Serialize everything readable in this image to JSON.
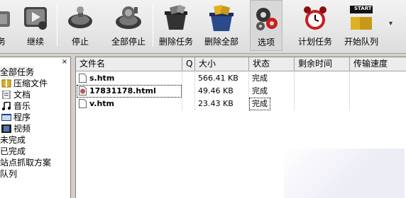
{
  "toolbar": {
    "buttons": [
      {
        "label": "务",
        "icon": "task-icon"
      },
      {
        "label": "继续",
        "icon": "resume-icon"
      },
      {
        "label": "停止",
        "icon": "stop-icon"
      },
      {
        "label": "全部停止",
        "icon": "stop-all-icon"
      },
      {
        "label": "删除任务",
        "icon": "delete-task-icon"
      },
      {
        "label": "删除全部",
        "icon": "delete-all-icon"
      },
      {
        "label": "选项",
        "icon": "options-gear-icon"
      },
      {
        "label": "计划任务",
        "icon": "alarm-clock-icon"
      },
      {
        "label": "开始队列",
        "icon": "start-queue-icon"
      }
    ],
    "start_badge": "START",
    "more_glyph": "▾"
  },
  "sidebar": {
    "close_glyph": "×",
    "items": [
      {
        "label": "全部任务",
        "icon": ""
      },
      {
        "label": "压缩文件",
        "icon": "archive-icon"
      },
      {
        "label": "文档",
        "icon": "document-icon"
      },
      {
        "label": "音乐",
        "icon": "music-icon"
      },
      {
        "label": "程序",
        "icon": "program-icon"
      },
      {
        "label": "视频",
        "icon": "video-icon"
      },
      {
        "label": "未完成",
        "icon": ""
      },
      {
        "label": "已完成",
        "icon": ""
      },
      {
        "label": "站点抓取方案",
        "icon": ""
      },
      {
        "label": "队列",
        "icon": ""
      }
    ]
  },
  "table": {
    "columns": [
      "文件名",
      "Q",
      "大小",
      "状态",
      "剩余时间",
      "传输速度"
    ],
    "rows": [
      {
        "name": "s.htm",
        "q": "",
        "size": "566.41 KB",
        "status": "完成",
        "remaining": "",
        "speed": "",
        "icon": "html-file-icon"
      },
      {
        "name": "17831178.html",
        "q": "",
        "size": "49.46 KB",
        "status": "完成",
        "remaining": "",
        "speed": "",
        "icon": "chrome-html-file-icon"
      },
      {
        "name": "v.htm",
        "q": "",
        "size": "23.43 KB",
        "status": "完成",
        "remaining": "",
        "speed": "",
        "icon": "html-file-icon"
      }
    ]
  },
  "colors": {
    "toolbar_bg": "#e6e6e6",
    "panel_bg": "#ffffff",
    "header_bg": "#ececec",
    "accent_red": "#c81e1e"
  }
}
